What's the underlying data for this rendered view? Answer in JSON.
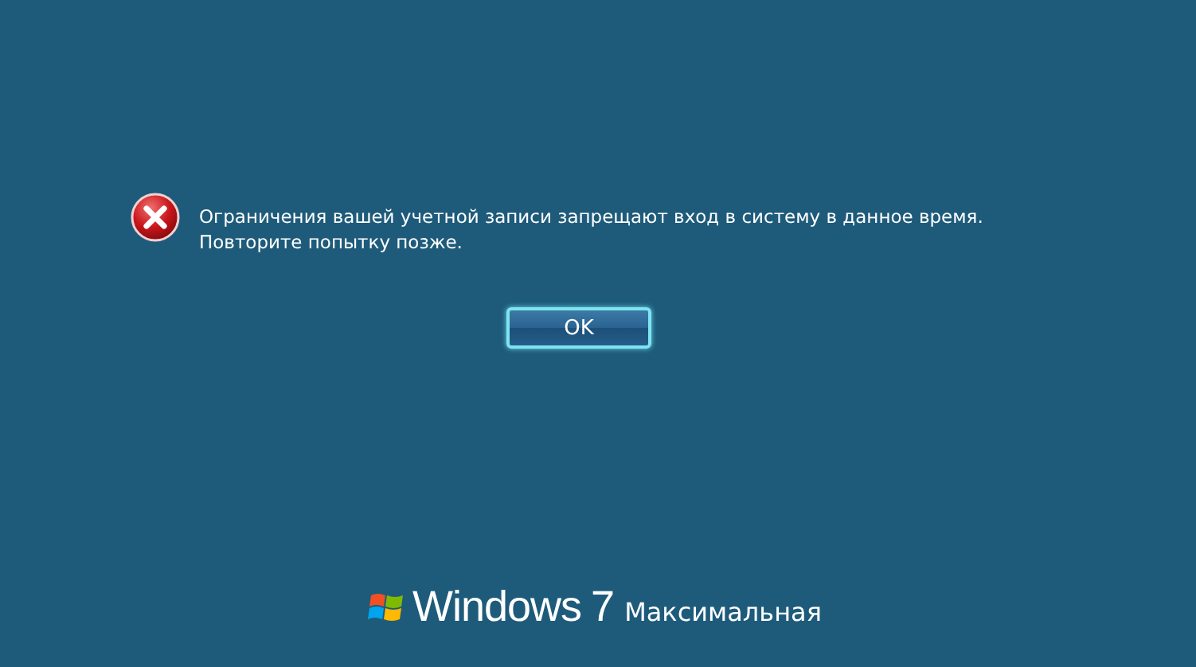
{
  "message": {
    "text": "Ограничения вашей учетной записи запрещают вход в систему в данное время. Повторите попытку позже."
  },
  "buttons": [
    "OK"
  ],
  "branding": {
    "product": "Windows",
    "version": "7",
    "edition": "Максимальная"
  }
}
